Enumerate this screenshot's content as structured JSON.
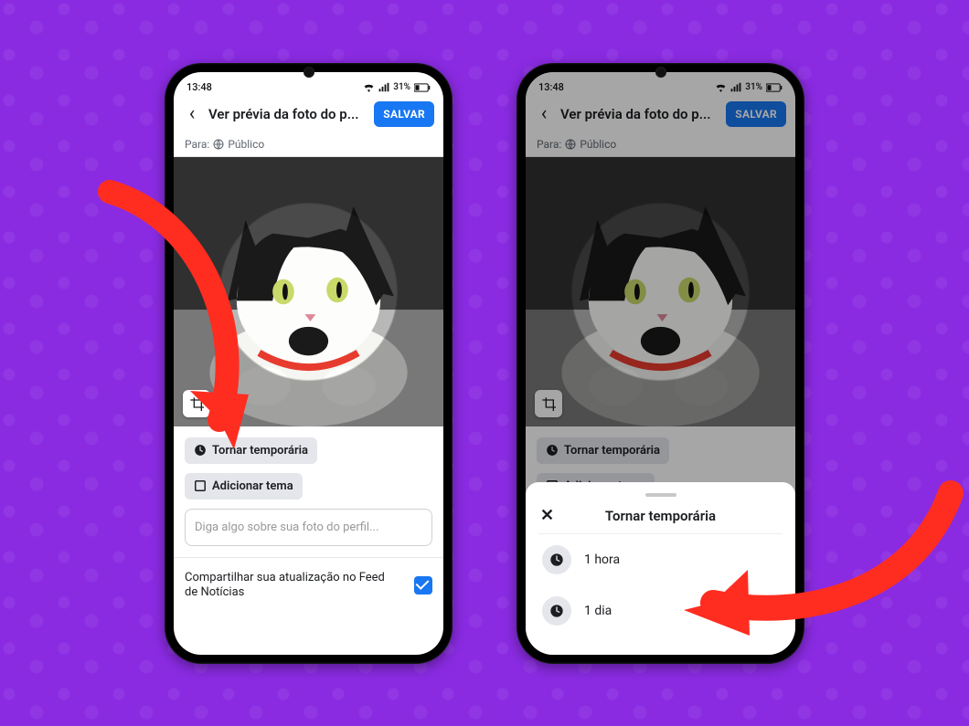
{
  "status_bar": {
    "time": "13:48",
    "battery_text": "31%"
  },
  "header": {
    "title": "Ver prévia da foto do p...",
    "save_label": "SALVAR"
  },
  "audience": {
    "prefix": "Para:",
    "value": "Público"
  },
  "chips": {
    "temporary": "Tornar temporária",
    "add_theme": "Adicionar tema"
  },
  "caption": {
    "placeholder": "Diga algo sobre sua foto do perfil..."
  },
  "share_feed": {
    "label": "Compartilhar sua atualização no Feed de Notícias",
    "checked": true
  },
  "sheet": {
    "title": "Tornar temporária",
    "options": [
      {
        "label": "1 hora"
      },
      {
        "label": "1 dia"
      }
    ]
  },
  "colors": {
    "accent_blue": "#1877f2",
    "arrow_red": "#ff2d20"
  }
}
